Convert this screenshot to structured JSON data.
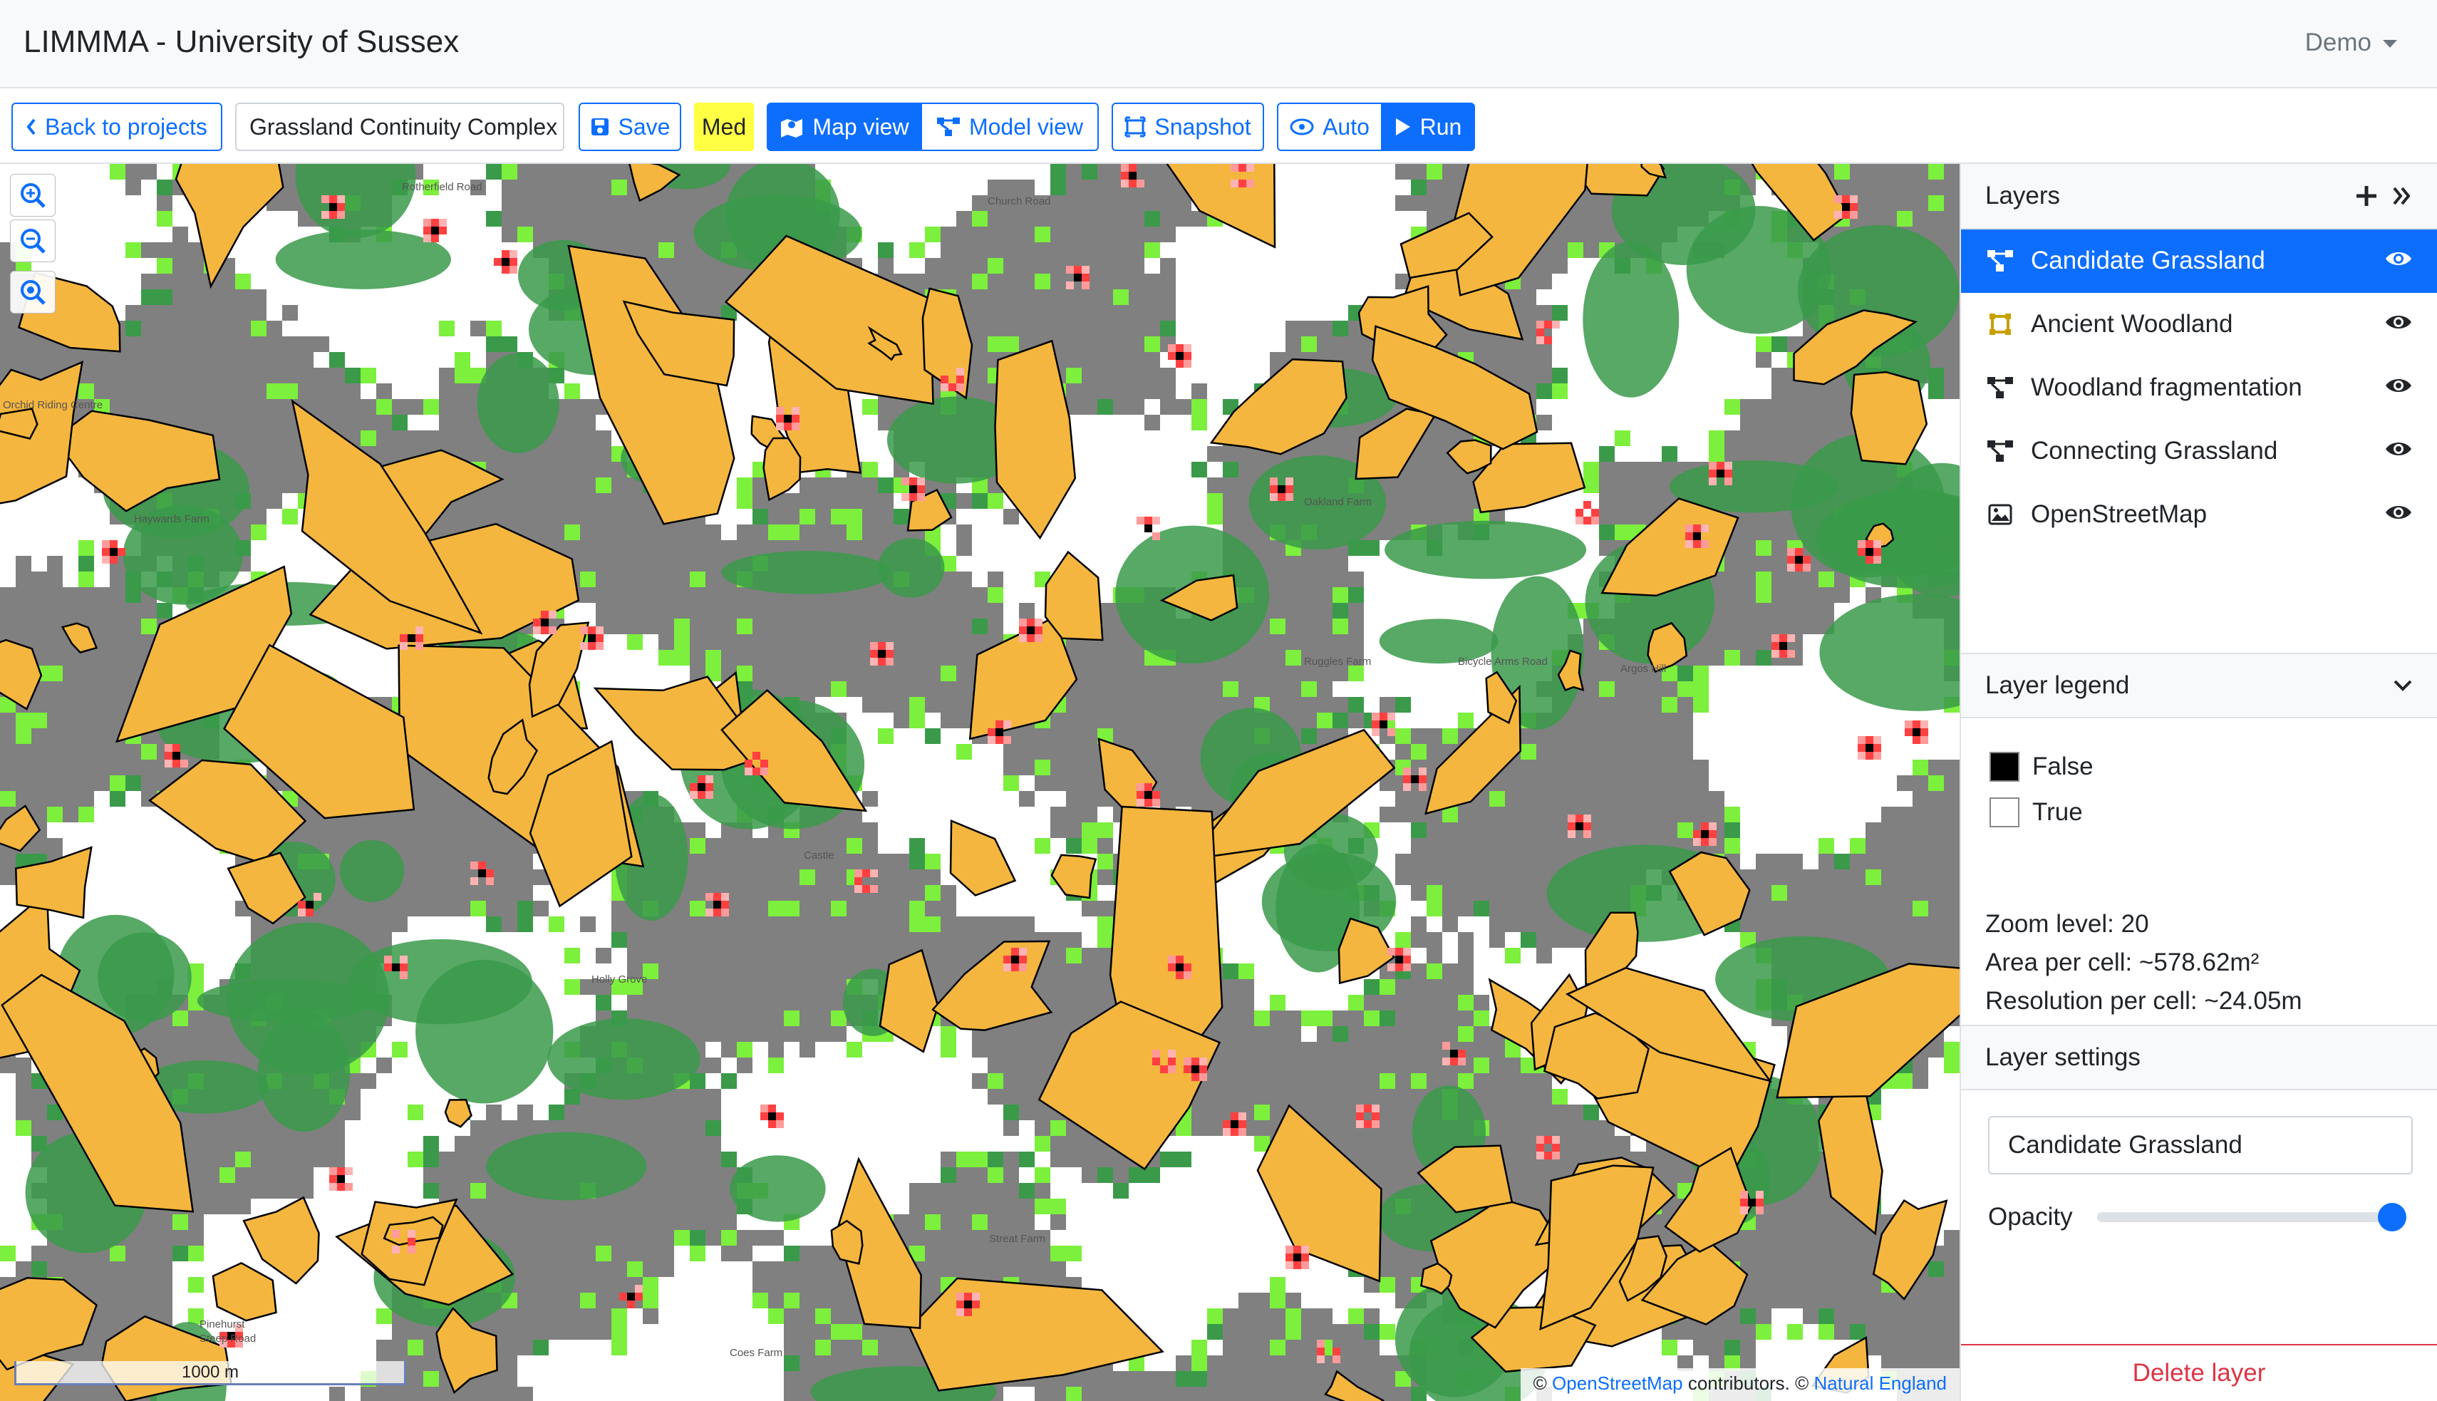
{
  "app": {
    "title": "LIMMMA - University of Sussex",
    "user_menu": "Demo"
  },
  "toolbar": {
    "back_label": "Back to projects",
    "project_name": "Grassland Continuity Complex",
    "save_label": "Save",
    "quality_badge": "Med",
    "map_view_label": "Map view",
    "model_view_label": "Model view",
    "snapshot_label": "Snapshot",
    "auto_label": "Auto",
    "run_label": "Run"
  },
  "map": {
    "scale_label": "1000 m",
    "attribution": {
      "prefix": "©",
      "osm": "OpenStreetMap",
      "middle": "contributors. ©",
      "ne": "Natural England"
    },
    "place_labels": [
      "Haywards Farm",
      "Holly Grove",
      "Ruggles Farm",
      "Oakland Farm",
      "Castle",
      "Streat Farm",
      "Pinehurst",
      "Steep Road",
      "Coes Farm",
      "Rotherfield Road",
      "Church Road",
      "Argos Hill",
      "Bicycle Arms Road",
      "Orchid Riding Centre"
    ],
    "colors": {
      "background": "#808080",
      "white_zone": "#ffffff",
      "woodland": "#3a9a4a",
      "grassland": "#f4b63f",
      "candidate": "#7cf03c",
      "hotspot": "#ff4040",
      "hotspot_core": "#000000"
    }
  },
  "panel": {
    "layers_title": "Layers",
    "layers": [
      {
        "label": "Candidate Grassland",
        "icon": "model-icon",
        "active": true
      },
      {
        "label": "Ancient Woodland",
        "icon": "dataset-icon",
        "active": false
      },
      {
        "label": "Woodland fragmentation",
        "icon": "model-icon",
        "active": false
      },
      {
        "label": "Connecting Grassland",
        "icon": "model-icon",
        "active": false
      },
      {
        "label": "OpenStreetMap",
        "icon": "image-icon",
        "active": false
      }
    ],
    "legend_title": "Layer legend",
    "legend": [
      {
        "label": "False",
        "color": "#000000"
      },
      {
        "label": "True",
        "color": "#ffffff"
      }
    ],
    "zoom_level": "Zoom level: 20",
    "area_per_cell": "Area per cell: ~578.62m²",
    "resolution_per_cell": "Resolution per cell: ~24.05m",
    "settings_title": "Layer settings",
    "layer_name_value": "Candidate Grassland",
    "opacity_label": "Opacity",
    "opacity_value": 1.0,
    "delete_label": "Delete layer"
  }
}
